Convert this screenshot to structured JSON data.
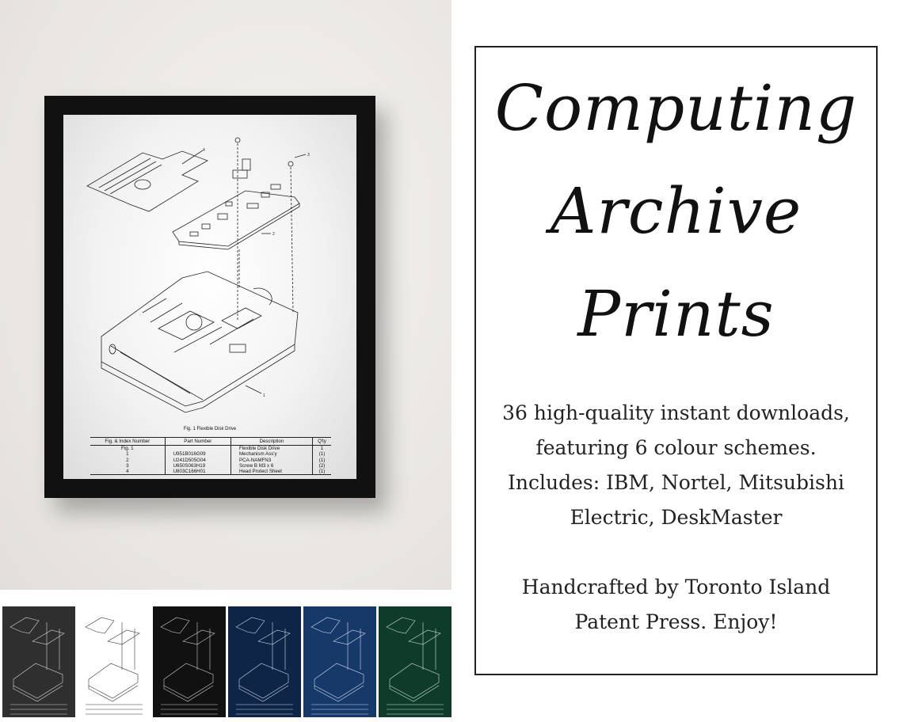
{
  "heading": {
    "line1": "Computing",
    "line2": "Archive",
    "line3": "Prints"
  },
  "description": "36 high-quality instant downloads, featuring 6 colour schemes. Includes: IBM, Nortel, Mitsubishi Electric, DeskMaster",
  "credit": "Handcrafted by Toronto Island Patent Press. Enjoy!",
  "print": {
    "caption": "Fig. 1    Flexible Disk Drive",
    "callouts": [
      "4",
      "3",
      "2",
      "1"
    ],
    "table": {
      "headers": [
        "Fig. & Index Number",
        "Part Number",
        "Description",
        "Q'ty"
      ],
      "rows": [
        [
          "Fig. 1",
          "",
          "Flexible Disk Drive",
          "1"
        ],
        [
          "1",
          "U951B016G09",
          "Mechanism Ass'y",
          "(1)"
        ],
        [
          "2",
          "U241D505G04",
          "PCA-NAMFN3",
          "(1)"
        ],
        [
          "3",
          "U650S063H19",
          "Screw B M3 x 6",
          "(2)"
        ],
        [
          "4",
          "U803C166H01",
          "Head Protect Sheet",
          "(1)"
        ]
      ]
    }
  },
  "colour_schemes": [
    {
      "name": "charcoal",
      "bg": "#2f2f2f",
      "ink": "#d8d8d8"
    },
    {
      "name": "white",
      "bg": "#ffffff",
      "ink": "#333333"
    },
    {
      "name": "black",
      "bg": "#111111",
      "ink": "#cfcfcf"
    },
    {
      "name": "navy",
      "bg": "#0f2547",
      "ink": "#c9d6ea"
    },
    {
      "name": "blueprint",
      "bg": "#17396a",
      "ink": "#d2deee"
    },
    {
      "name": "green",
      "bg": "#0f3b2a",
      "ink": "#cfe3d8"
    }
  ]
}
